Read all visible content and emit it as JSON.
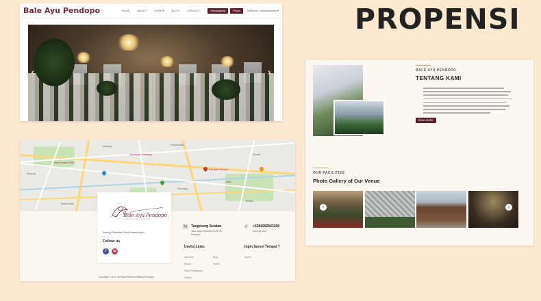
{
  "title": "PROPENSI",
  "site": {
    "logo": "Bale Ayu Pendopo",
    "nav": [
      "HOME",
      "ABOUT",
      "VIEW",
      "BLOG",
      "CONTACT"
    ],
    "view_caret": "▾",
    "btn_primary": "Wisata/ganig",
    "btn_secondary": "Pesan",
    "welcome": "Welcome, customerdemo ▾",
    "hero_prev": "‹",
    "hero_next": "›"
  },
  "about": {
    "kicker": "BALE AYU PENDOPO",
    "heading": "TENTANG KAMI",
    "read_more": "READ MORE",
    "facilities_kicker": "OUR FACILITIES",
    "gallery_title": "Photo Gallery of Our Venue",
    "gallery_prev": "‹",
    "gallery_next": "›"
  },
  "footer": {
    "logo_text": "Bale Ayu Pendopo",
    "logo_sub": "WEDDING & EVENT VENUE",
    "description": "Gedung Pernikahan Pada Suasana Ayem",
    "follow_us": "Follow us",
    "social_fb": "f",
    "social_ig": "ig",
    "location_head": "Tangerang Selatan",
    "location_sub1": "Jalan Raya Siliwangi No.08 Rd",
    "location_sub2": "Pisangan",
    "phone_head": "+6281992543208",
    "phone_sub": "Hubungi kami",
    "useful_links": "Useful Links",
    "links_col1": [
      "About Us",
      "Pesan",
      "Paket Pernikahan",
      "Gallery"
    ],
    "links_col2": [
      "Blog",
      "Profile"
    ],
    "survey_head": "Ingin Survei Tempat ?",
    "survey_link": "Survei",
    "copyright": "Copyright © 2020, All Right Reserved BaleAyuPendopo"
  },
  "map": {
    "labels": [
      "Pasar Modern BSD",
      "Universitas Pamulang",
      "Bale Ayu Pendopo",
      "Pondok Aren",
      "Serpong",
      "Ciputat",
      "Pamulang",
      "Bintaro",
      "Jombang",
      "Rawa Buntu",
      "Ciater",
      "Benda Baru"
    ]
  },
  "colors": {
    "accent": "#5b1f2e",
    "logo": "#6b2b3a",
    "background": "#fde9d0",
    "gold": "#c8a070"
  }
}
